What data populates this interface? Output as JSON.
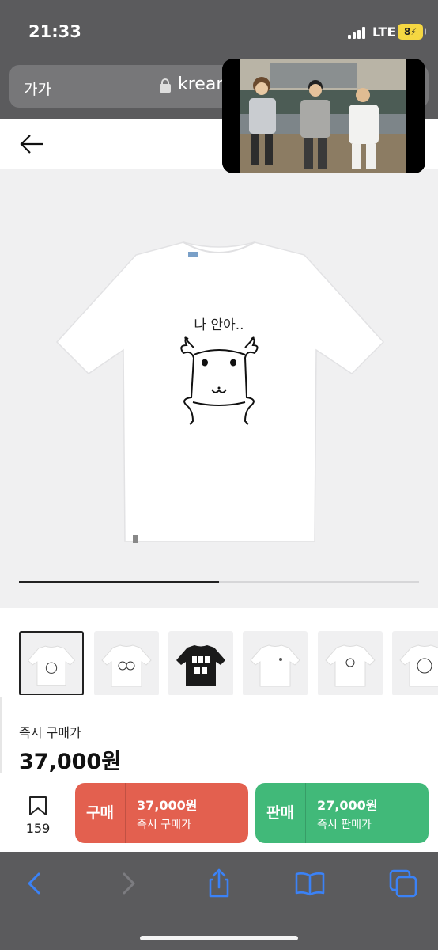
{
  "status_bar": {
    "time": "21:33",
    "network": "LTE",
    "battery": "8"
  },
  "browser": {
    "text_size_button": "가가",
    "url_text": "krear"
  },
  "product": {
    "print_text": "나 안아..",
    "image_progress": 0.5
  },
  "thumbnails": {
    "count_visible": 6,
    "selected_index": 0
  },
  "price": {
    "label": "즉시 구매가",
    "value": "37,000원"
  },
  "actions": {
    "wish_count": "159",
    "buy": {
      "label": "구매",
      "price": "37,000원",
      "desc": "즉시 구매가"
    },
    "sell": {
      "label": "판매",
      "price": "27,000원",
      "desc": "즉시 판매가"
    }
  },
  "colors": {
    "buy": "#e3604f",
    "sell": "#41b979",
    "chrome": "#5b5b5d",
    "toolbar_icon": "#3b82f6"
  }
}
